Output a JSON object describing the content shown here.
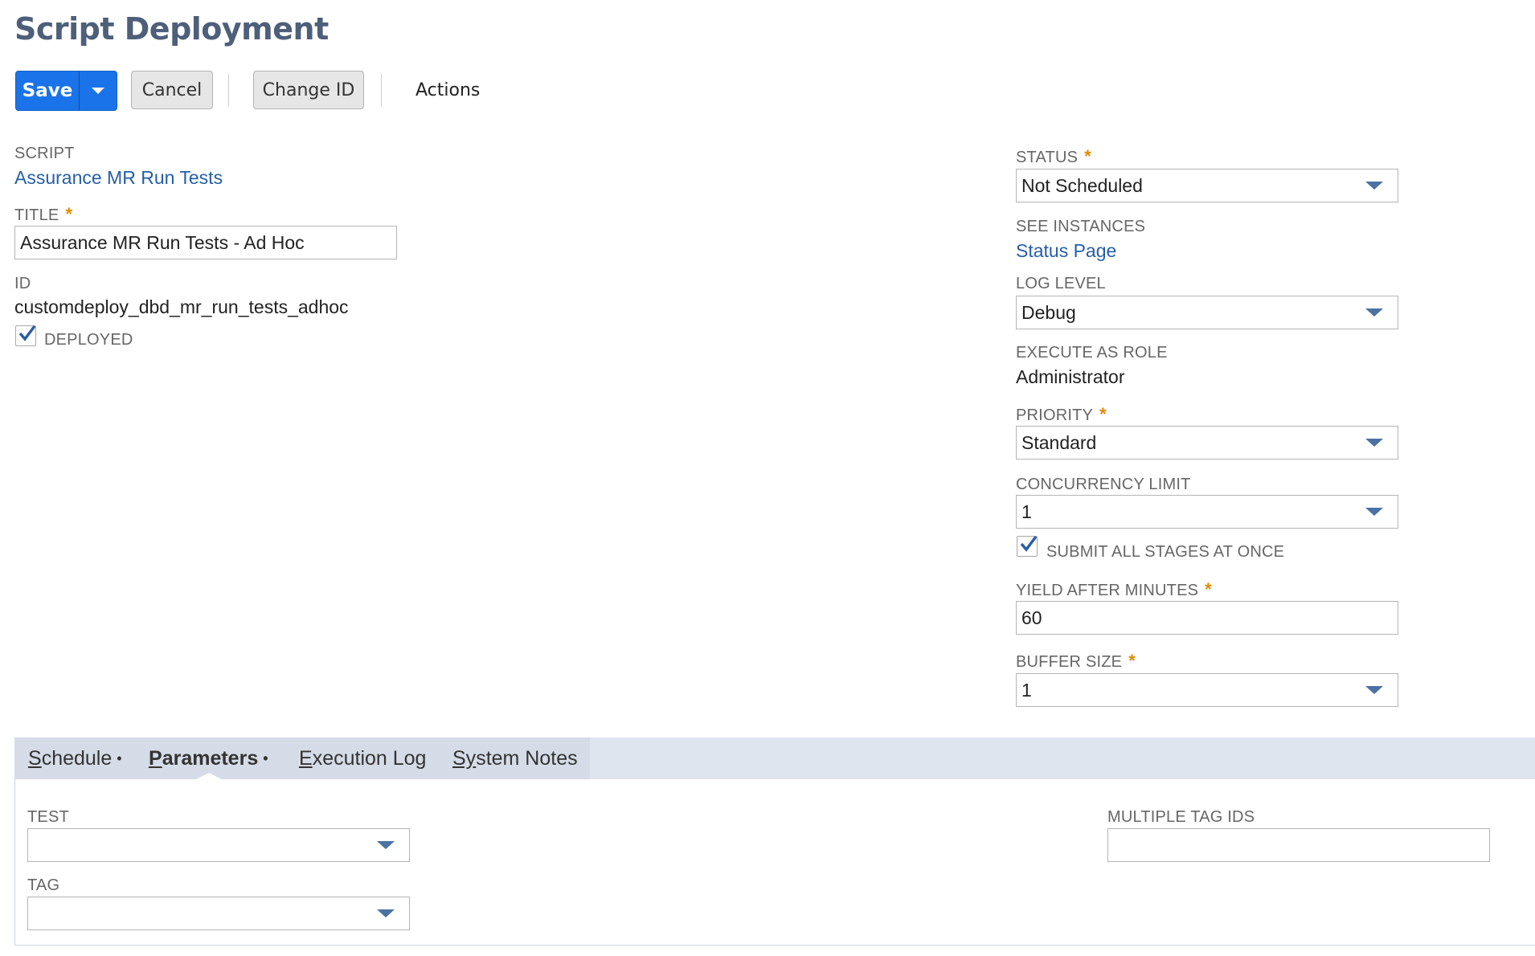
{
  "page_title": "Script Deployment",
  "toolbar": {
    "save_label": "Save",
    "cancel_label": "Cancel",
    "change_id_label": "Change ID",
    "actions_label": "Actions"
  },
  "left": {
    "script_label": "SCRIPT",
    "script_value": "Assurance MR Run Tests",
    "title_label": "TITLE",
    "title_value": "Assurance MR Run Tests - Ad Hoc",
    "id_label": "ID",
    "id_value": "customdeploy_dbd_mr_run_tests_adhoc",
    "deployed_label": "DEPLOYED",
    "deployed_checked": true
  },
  "right": {
    "status_label": "STATUS",
    "status_value": "Not Scheduled",
    "see_instances_label": "SEE INSTANCES",
    "see_instances_link": "Status Page",
    "log_level_label": "LOG LEVEL",
    "log_level_value": "Debug",
    "execute_as_role_label": "EXECUTE AS ROLE",
    "execute_as_role_value": "Administrator",
    "priority_label": "PRIORITY",
    "priority_value": "Standard",
    "concurrency_label": "CONCURRENCY LIMIT",
    "concurrency_value": "1",
    "submit_all_label": "SUBMIT ALL STAGES AT ONCE",
    "submit_all_checked": true,
    "yield_label": "YIELD AFTER MINUTES",
    "yield_value": "60",
    "buffer_label": "BUFFER SIZE",
    "buffer_value": "1"
  },
  "required_marker": "*",
  "tabs": [
    {
      "first": "S",
      "rest": "chedule",
      "bullet": "•",
      "active": false
    },
    {
      "first": "P",
      "rest": "arameters",
      "bullet": "•",
      "active": true
    },
    {
      "first": "E",
      "rest": "xecution Log",
      "bullet": "",
      "active": false
    },
    {
      "first": "Sy",
      "rest": "stem Notes",
      "bullet": "",
      "active": false
    }
  ],
  "parameters": {
    "test_label": "TEST",
    "test_value": "",
    "tag_label": "TAG",
    "tag_value": "",
    "multiple_tag_ids_label": "MULTIPLE TAG IDS",
    "multiple_tag_ids_value": ""
  },
  "colors": {
    "accent": "#1a73e8",
    "title": "#4d5f79",
    "link": "#255ea8",
    "required": "#e08a00",
    "tabbar": "#dfe5ee"
  }
}
